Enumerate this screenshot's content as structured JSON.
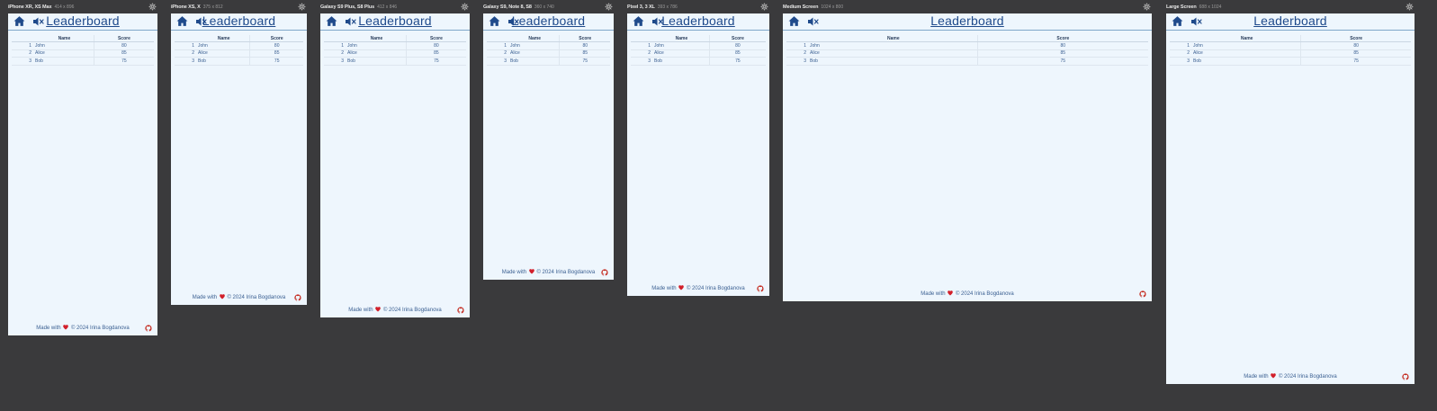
{
  "app": {
    "title": "Leaderboard",
    "columns": {
      "name": "Name",
      "score": "Score"
    },
    "rows": [
      {
        "rank": "1",
        "name": "John",
        "score": "80"
      },
      {
        "rank": "2",
        "name": "Alice",
        "score": "85"
      },
      {
        "rank": "3",
        "name": "Bob",
        "score": "75"
      }
    ],
    "footer": {
      "prefix": "Made with",
      "suffix": "© 2024 Irina Bogdanova"
    }
  },
  "devices": [
    {
      "name": "iPhone XR, XS Max",
      "size": "414 x 896"
    },
    {
      "name": "iPhone XS, X",
      "size": "375 x 812"
    },
    {
      "name": "Galaxy S9 Plus, S8 Plus",
      "size": "412 x 846"
    },
    {
      "name": "Galaxy S9, Note 8, S8",
      "size": "360 x 740"
    },
    {
      "name": "Pixel 3, 3 XL",
      "size": "393 x 786"
    },
    {
      "name": "Medium Screen",
      "size": "1024 x 800"
    },
    {
      "name": "Large Screen",
      "size": "688 x 1024"
    }
  ],
  "colors": {
    "accent": "#1f4a8b",
    "heart": "#d21f2a",
    "github": "#c42a1f",
    "screen_bg": "#eef6fd"
  }
}
